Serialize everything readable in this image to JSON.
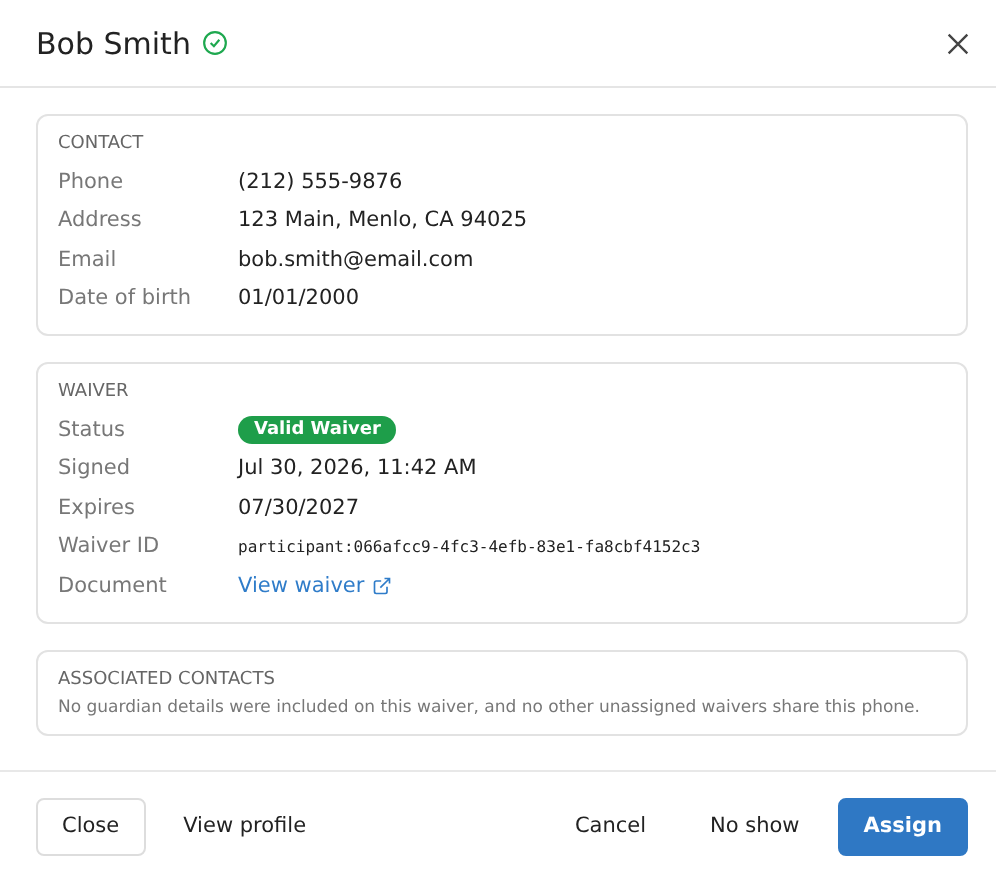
{
  "dialog": {
    "title": "Bob Smith",
    "verified": true
  },
  "sections": [
    {
      "title": "CONTACT",
      "rows": [
        {
          "label": "Phone",
          "kind": "text",
          "value": "(212) 555-9876"
        },
        {
          "label": "Address",
          "kind": "text",
          "value": "123 Main, Menlo, CA 94025"
        },
        {
          "label": "Email",
          "kind": "text",
          "value": "bob.smith@email.com"
        },
        {
          "label": "Date of birth",
          "kind": "text",
          "value": "01/01/2000"
        }
      ]
    },
    {
      "title": "WAIVER",
      "rows": [
        {
          "label": "Status",
          "kind": "badge",
          "value": "Valid Waiver",
          "color": "#1e9e4a"
        },
        {
          "label": "Signed",
          "kind": "text",
          "value": "Jul 30, 2026, 11:42 AM"
        },
        {
          "label": "Expires",
          "kind": "text",
          "value": "07/30/2027"
        },
        {
          "label": "Waiver ID",
          "kind": "mono",
          "value": "participant:066afcc9-4fc3-4efb-83e1-fa8cbf4152c3"
        },
        {
          "label": "Document",
          "kind": "link",
          "value": "View waiver"
        }
      ]
    },
    {
      "title": "ASSOCIATED CONTACTS",
      "note": "No guardian details were included on this waiver, and no other unassigned waivers share this phone."
    }
  ],
  "footer": {
    "left": [
      {
        "label": "Close",
        "kind": "outline"
      },
      {
        "label": "View profile",
        "kind": "ghost"
      }
    ],
    "right": [
      {
        "label": "Cancel",
        "kind": "ghost"
      },
      {
        "label": "No show",
        "kind": "ghost"
      },
      {
        "label": "Assign",
        "kind": "primary"
      }
    ]
  }
}
